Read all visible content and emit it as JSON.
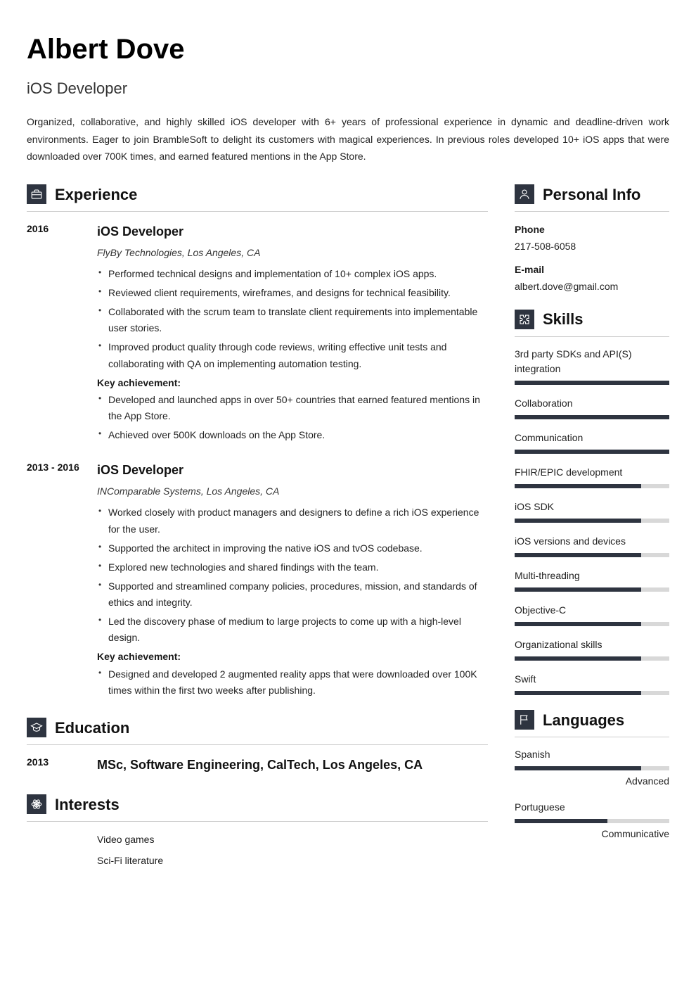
{
  "name": "Albert Dove",
  "role": "iOS Developer",
  "summary": "Organized, collaborative, and highly skilled iOS developer with 6+ years of professional experience in dynamic and deadline-driven work environments. Eager to join BrambleSoft to delight its customers with magical experiences. In previous roles developed 10+ iOS apps that were downloaded over 700K times, and earned featured mentions in the App Store.",
  "sections": {
    "experience": "Experience",
    "education": "Education",
    "interests": "Interests",
    "personal_info": "Personal Info",
    "skills": "Skills",
    "languages": "Languages"
  },
  "experience": [
    {
      "date": "2016",
      "title": "iOS Developer",
      "subtitle": "FlyBy Technologies, Los Angeles, CA",
      "bullets": [
        "Performed technical designs and implementation of 10+ complex iOS apps.",
        "Reviewed client requirements, wireframes, and designs for technical feasibility.",
        "Collaborated with the scrum team to translate client requirements into implementable user stories.",
        "Improved product quality through code reviews, writing effective unit tests and collaborating with QA on implementing automation testing."
      ],
      "key_label": "Key achievement:",
      "achievements": [
        "Developed and launched apps in over 50+ countries that earned featured mentions in the App Store.",
        "Achieved over 500K downloads on the App Store."
      ]
    },
    {
      "date": "2013 - 2016",
      "title": "iOS Developer",
      "subtitle": "INComparable Systems, Los Angeles, CA",
      "bullets": [
        "Worked closely with product managers and designers to define a rich iOS experience for the user.",
        "Supported the architect in improving the native iOS and tvOS codebase.",
        "Explored new technologies and shared findings with the team.",
        "Supported and streamlined company policies, procedures, mission, and standards of ethics and integrity.",
        "Led the discovery phase of medium to large projects to come up with a high-level design."
      ],
      "key_label": "Key achievement:",
      "achievements": [
        "Designed and developed 2 augmented reality apps that were downloaded over 100K times within the first two weeks after publishing."
      ]
    }
  ],
  "education": [
    {
      "date": "2013",
      "title": "MSc, Software Engineering,  CalTech, Los Angeles, CA"
    }
  ],
  "interests": [
    "Video games",
    "Sci-Fi literature"
  ],
  "personal_info": {
    "phone_label": "Phone",
    "phone": "217-508-6058",
    "email_label": "E-mail",
    "email": "albert.dove@gmail.com"
  },
  "skills": [
    {
      "name": "3rd party SDKs and API(S) integration",
      "pct": 100
    },
    {
      "name": "Collaboration",
      "pct": 100
    },
    {
      "name": "Communication",
      "pct": 100
    },
    {
      "name": "FHIR/EPIC development",
      "pct": 82
    },
    {
      "name": "iOS SDK",
      "pct": 82
    },
    {
      "name": "iOS versions and devices",
      "pct": 82
    },
    {
      "name": "Multi-threading",
      "pct": 82
    },
    {
      "name": "Objective-C",
      "pct": 82
    },
    {
      "name": "Organizational skills",
      "pct": 82
    },
    {
      "name": "Swift",
      "pct": 82
    }
  ],
  "languages": [
    {
      "name": "Spanish",
      "pct": 82,
      "level": "Advanced"
    },
    {
      "name": "Portuguese",
      "pct": 60,
      "level": "Communicative"
    }
  ]
}
